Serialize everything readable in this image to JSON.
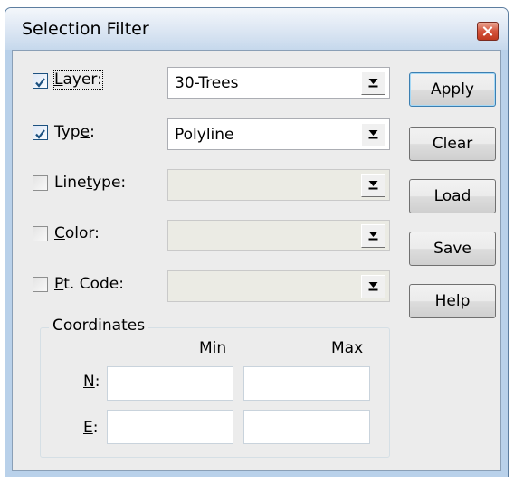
{
  "window": {
    "title": "Selection Filter",
    "close_icon": "close-icon"
  },
  "filters": [
    {
      "label_pre": "",
      "label_key": "L",
      "label_post": "ayer:",
      "checked": true,
      "value": "30-Trees",
      "enabled": true
    },
    {
      "label_pre": "Typ",
      "label_key": "e",
      "label_post": ":",
      "checked": true,
      "value": "Polyline",
      "enabled": true
    },
    {
      "label_pre": "Line",
      "label_key": "t",
      "label_post": "ype:",
      "checked": false,
      "value": "",
      "enabled": false
    },
    {
      "label_pre": "",
      "label_key": "C",
      "label_post": "olor:",
      "checked": false,
      "value": "",
      "enabled": false
    },
    {
      "label_pre": "",
      "label_key": "P",
      "label_post": "t. Code:",
      "checked": false,
      "value": "",
      "enabled": false
    }
  ],
  "buttons": {
    "apply": "Apply",
    "clear": "Clear",
    "load": "Load",
    "save": "Save",
    "help": "Help"
  },
  "coordinates": {
    "title": "Coordinates",
    "min_label": "Min",
    "max_label": "Max",
    "n_key": "N",
    "n_post": ":",
    "e_key": "E",
    "e_post": ":",
    "n_min": "",
    "n_max": "",
    "e_min": "",
    "e_max": ""
  },
  "colors": {
    "titlebar": "#dbe6f3",
    "client": "#ececec",
    "close": "#d4543c",
    "check": "#1c5180"
  }
}
